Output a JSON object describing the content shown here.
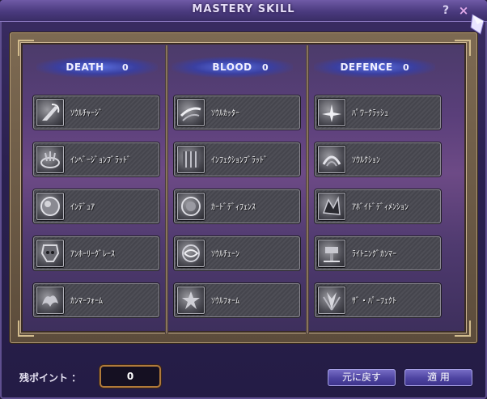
{
  "window": {
    "title": "MASTERY SKILL",
    "help": "?",
    "close": "×"
  },
  "columns": [
    {
      "name": "DEATH",
      "points": "0",
      "skills": [
        "ｿｳﾙﾁｬｰｼﾞ",
        "ｲﾝﾍﾞｰｼﾞｮﾝﾌﾞﾗｯﾄﾞ",
        "ｲﾝﾃﾞｭｱ",
        "ｱﾝﾎｰﾘｰｸﾞﾚｰｽ",
        "ｶﾝﾏｰﾌｫｰﾑ"
      ]
    },
    {
      "name": "BLOOD",
      "points": "0",
      "skills": [
        "ｿｳﾙｶｯﾀｰ",
        "ｲﾝﾌｪｸｼｮﾝﾌﾞﾗｯﾄﾞ",
        "ｶｰﾄﾞﾃﾞｨﾌｪﾝｽ",
        "ｿｳﾙﾁｪｰﾝ",
        "ｿｳﾙﾌｫｰﾑ"
      ]
    },
    {
      "name": "DEFENCE",
      "points": "0",
      "skills": [
        "ﾊﾟﾜｰｸﾗｯｼｭ",
        "ｿｳﾙｸｼｮﾝ",
        "ｱﾎﾞｲﾄﾞﾃﾞｨﾒﾝｼｮﾝ",
        "ﾗｲﾄﾆﾝｸﾞｶﾝﾏｰ",
        "ｻﾞ・ﾊﾟｰﾌｪｸﾄ"
      ]
    }
  ],
  "footer": {
    "points_label": "残ポイント ：",
    "points_value": "0",
    "reset_button": "元に戻す",
    "apply_button": "適 用"
  },
  "icons": {
    "column_0": [
      "scythe-slash-icon",
      "blood-splash-icon",
      "orb-shield-icon",
      "skull-grace-icon",
      "demon-form-icon"
    ],
    "column_1": [
      "blade-wind-icon",
      "infected-blood-icon",
      "guard-orb-icon",
      "soul-chain-icon",
      "soul-form-icon"
    ],
    "column_2": [
      "power-crash-icon",
      "soul-cushion-icon",
      "void-dimension-icon",
      "lightning-hammer-icon",
      "perfect-wings-icon"
    ]
  }
}
